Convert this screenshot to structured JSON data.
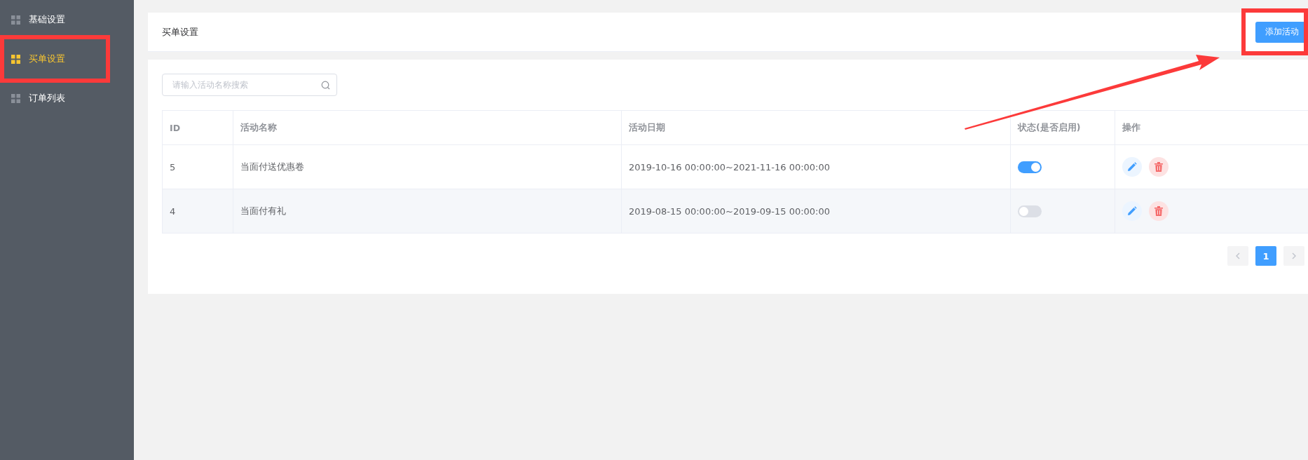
{
  "sidebar": {
    "items": [
      {
        "label": "基础设置",
        "selected": false
      },
      {
        "label": "买单设置",
        "selected": true
      },
      {
        "label": "订单列表",
        "selected": false
      }
    ]
  },
  "header": {
    "title": "买单设置",
    "add_button": "添加活动"
  },
  "search": {
    "placeholder": "请输入活动名称搜索"
  },
  "table": {
    "columns": [
      "ID",
      "活动名称",
      "活动日期",
      "状态(是否启用)",
      "操作"
    ],
    "rows": [
      {
        "id": "5",
        "name": "当面付送优惠卷",
        "date": "2019-10-16 00:00:00~2021-11-16 00:00:00",
        "on": true
      },
      {
        "id": "4",
        "name": "当面付有礼",
        "date": "2019-08-15 00:00:00~2019-09-15 00:00:00",
        "on": false
      }
    ]
  },
  "pagination": {
    "pages": [
      {
        "label": "1",
        "selected": true
      }
    ]
  }
}
